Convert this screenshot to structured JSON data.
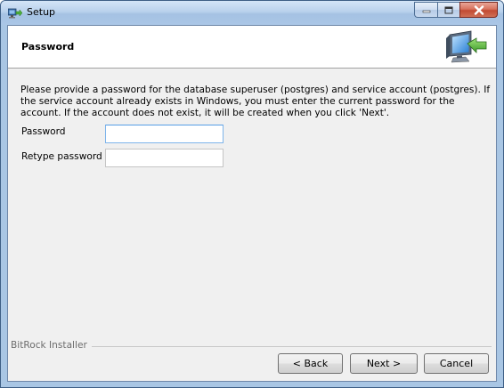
{
  "window": {
    "title": "Setup"
  },
  "header": {
    "title": "Password"
  },
  "body": {
    "description": "Please provide a password for the database superuser (postgres) and service account (postgres). If the service account already exists in Windows, you must enter the current password for the account. If the account does not exist, it will be created when you click 'Next'."
  },
  "form": {
    "password_label": "Password",
    "password_value": "",
    "retype_label": "Retype password",
    "retype_value": ""
  },
  "footer": {
    "installer_label": "BitRock Installer",
    "back_label": "< Back",
    "next_label": "Next >",
    "cancel_label": "Cancel"
  }
}
